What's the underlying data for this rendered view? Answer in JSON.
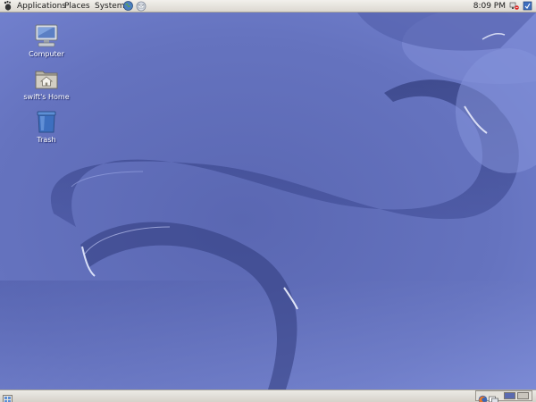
{
  "top_panel": {
    "menus": {
      "applications": "Applications",
      "places": "Places",
      "system": "System"
    },
    "clock": "8:09 PM"
  },
  "desktop": {
    "icons": [
      {
        "label": "Computer",
        "icon": "computer-icon"
      },
      {
        "label": "swift's Home",
        "icon": "home-folder-icon"
      },
      {
        "label": "Trash",
        "icon": "trash-icon"
      }
    ]
  },
  "bottom_panel": {
    "workspaces": {
      "count": 2,
      "active": 1
    }
  },
  "colors": {
    "wallpaper_base": "#6877c4",
    "wallpaper_dark": "#2b3670",
    "panel_bg": "#e8e5df"
  }
}
